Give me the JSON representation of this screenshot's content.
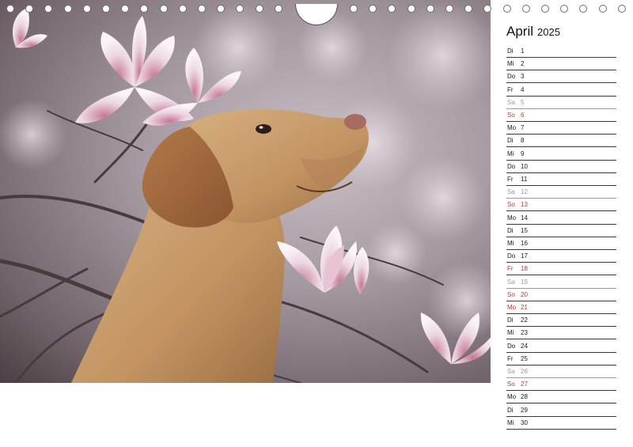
{
  "calendar": {
    "month": "April",
    "year": "2025",
    "days": [
      {
        "wd": "Di",
        "d": "1",
        "kind": "normal"
      },
      {
        "wd": "Mi",
        "d": "2",
        "kind": "normal"
      },
      {
        "wd": "Do",
        "d": "3",
        "kind": "normal"
      },
      {
        "wd": "Fr",
        "d": "4",
        "kind": "normal"
      },
      {
        "wd": "Sa",
        "d": "5",
        "kind": "sat"
      },
      {
        "wd": "So",
        "d": "6",
        "kind": "red"
      },
      {
        "wd": "Mo",
        "d": "7",
        "kind": "normal"
      },
      {
        "wd": "Di",
        "d": "8",
        "kind": "normal"
      },
      {
        "wd": "Mi",
        "d": "9",
        "kind": "normal"
      },
      {
        "wd": "Do",
        "d": "10",
        "kind": "normal"
      },
      {
        "wd": "Fr",
        "d": "11",
        "kind": "normal"
      },
      {
        "wd": "Sa",
        "d": "12",
        "kind": "sat"
      },
      {
        "wd": "So",
        "d": "13",
        "kind": "red"
      },
      {
        "wd": "Mo",
        "d": "14",
        "kind": "normal"
      },
      {
        "wd": "Di",
        "d": "15",
        "kind": "normal"
      },
      {
        "wd": "Mi",
        "d": "16",
        "kind": "normal"
      },
      {
        "wd": "Do",
        "d": "17",
        "kind": "normal"
      },
      {
        "wd": "Fr",
        "d": "18",
        "kind": "red"
      },
      {
        "wd": "Sa",
        "d": "19",
        "kind": "sat"
      },
      {
        "wd": "So",
        "d": "20",
        "kind": "red"
      },
      {
        "wd": "Mo",
        "d": "21",
        "kind": "red"
      },
      {
        "wd": "Di",
        "d": "22",
        "kind": "normal"
      },
      {
        "wd": "Mi",
        "d": "23",
        "kind": "normal"
      },
      {
        "wd": "Do",
        "d": "24",
        "kind": "normal"
      },
      {
        "wd": "Fr",
        "d": "25",
        "kind": "normal"
      },
      {
        "wd": "Sa",
        "d": "26",
        "kind": "sat"
      },
      {
        "wd": "So",
        "d": "27",
        "kind": "red"
      },
      {
        "wd": "Mo",
        "d": "28",
        "kind": "normal"
      },
      {
        "wd": "Di",
        "d": "29",
        "kind": "normal"
      },
      {
        "wd": "Mi",
        "d": "30",
        "kind": "normal"
      }
    ]
  },
  "colors": {
    "holiday_red": "#c0392b",
    "saturday_grey": "#9a9a9a",
    "text": "#1a1a1a"
  },
  "photo": {
    "subject": "labrador-dog-magnolia-blossoms"
  }
}
